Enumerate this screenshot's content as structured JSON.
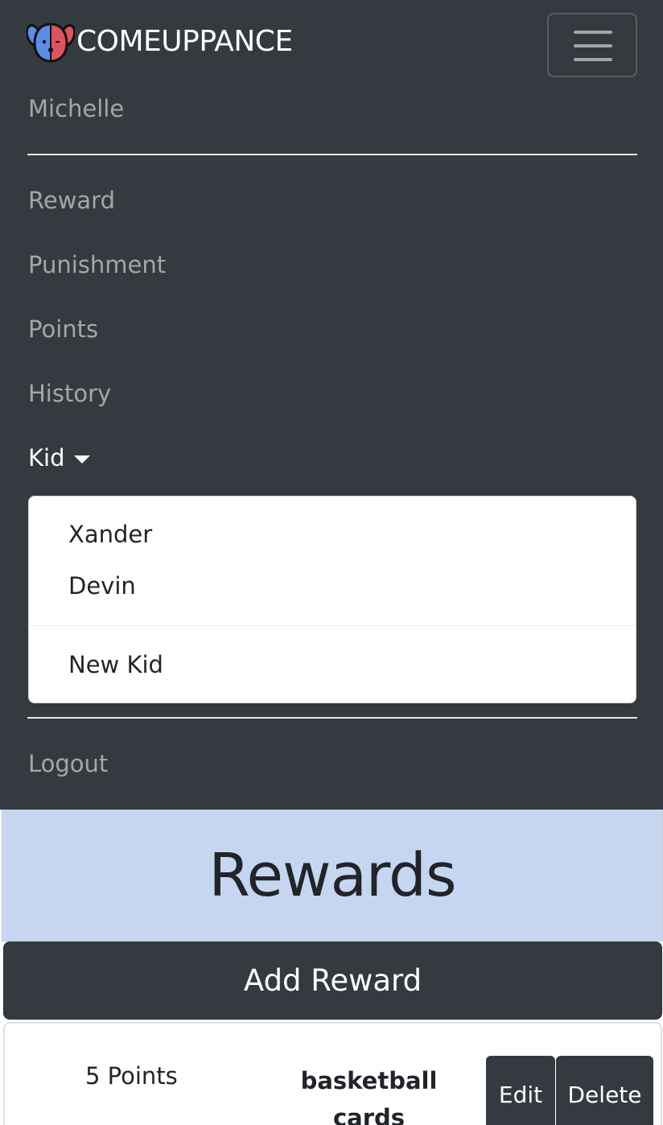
{
  "navbar": {
    "brand": "COMEUPPANCE",
    "user": "Michelle",
    "links": [
      "Reward",
      "Punishment",
      "Points",
      "History"
    ],
    "kid_menu": {
      "label": "Kid",
      "items": [
        "Xander",
        "Devin"
      ],
      "extra": "New Kid"
    },
    "logout": "Logout"
  },
  "page": {
    "title": "Rewards",
    "add_button": "Add Reward"
  },
  "rewards": [
    {
      "points": "5 Points",
      "name": "basketball cards",
      "edit": "Edit",
      "delete": "Delete"
    }
  ],
  "colors": {
    "navbar_bg": "#343a40",
    "jumbotron_bg": "#c7d6f0",
    "logo_blue": "#5b8de6",
    "logo_red": "#d9545e"
  }
}
